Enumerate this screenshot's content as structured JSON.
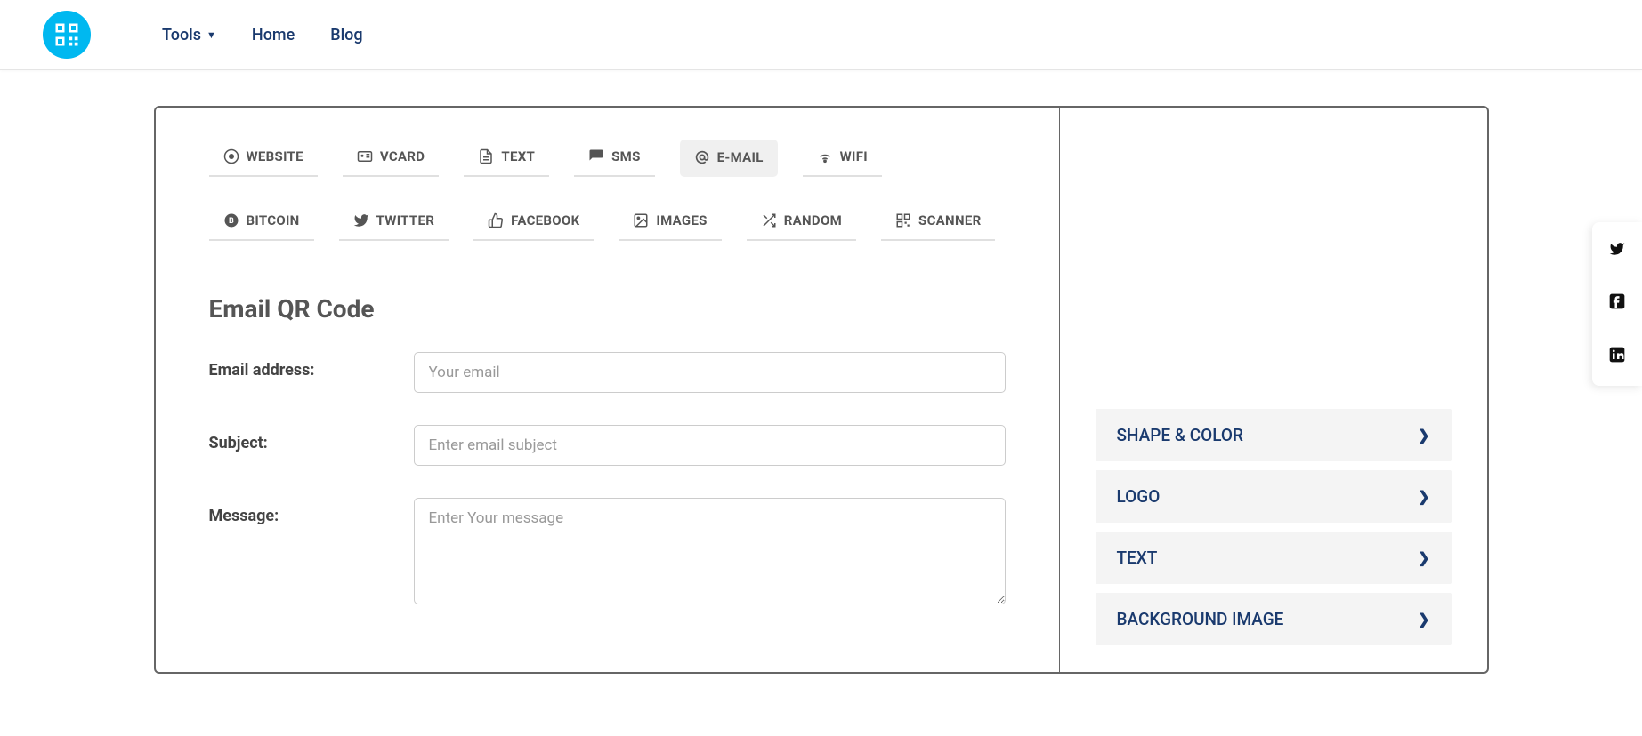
{
  "nav": {
    "tools": "Tools",
    "home": "Home",
    "blog": "Blog"
  },
  "tabs": [
    {
      "id": "website",
      "label": "WEBSITE",
      "icon": "chrome"
    },
    {
      "id": "vcard",
      "label": "VCARD",
      "icon": "id-card"
    },
    {
      "id": "text",
      "label": "TEXT",
      "icon": "file"
    },
    {
      "id": "sms",
      "label": "SMS",
      "icon": "sms"
    },
    {
      "id": "email",
      "label": "E-MAIL",
      "icon": "at"
    },
    {
      "id": "wifi",
      "label": "WIFI",
      "icon": "wifi"
    },
    {
      "id": "bitcoin",
      "label": "BITCOIN",
      "icon": "bitcoin"
    },
    {
      "id": "twitter",
      "label": "TWITTER",
      "icon": "twitter"
    },
    {
      "id": "facebook",
      "label": "FACEBOOK",
      "icon": "thumbs-up"
    },
    {
      "id": "images",
      "label": "IMAGES",
      "icon": "image"
    },
    {
      "id": "random",
      "label": "RANDOM",
      "icon": "shuffle"
    },
    {
      "id": "scanner",
      "label": "SCANNER",
      "icon": "qr"
    }
  ],
  "active_tab": "email",
  "form": {
    "title": "Email QR Code",
    "email_label": "Email address:",
    "email_placeholder": "Your email",
    "email_value": "",
    "subject_label": "Subject:",
    "subject_placeholder": "Enter email subject",
    "subject_value": "",
    "message_label": "Message:",
    "message_placeholder": "Enter Your message",
    "message_value": ""
  },
  "accordion": [
    {
      "label": "SHAPE & COLOR"
    },
    {
      "label": "LOGO"
    },
    {
      "label": "TEXT"
    },
    {
      "label": "BACKGROUND IMAGE"
    }
  ],
  "social": [
    {
      "name": "twitter"
    },
    {
      "name": "facebook"
    },
    {
      "name": "linkedin"
    }
  ],
  "colors": {
    "brand": "#00b8f0",
    "nav_link": "#1a3a6e"
  }
}
